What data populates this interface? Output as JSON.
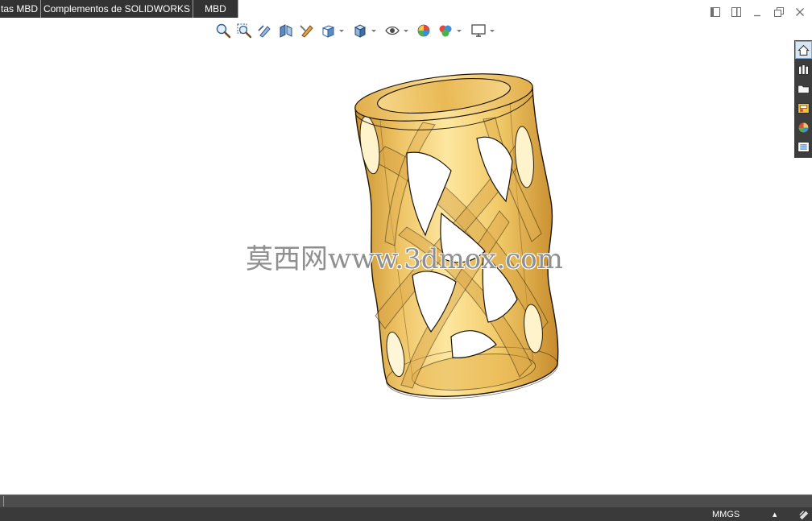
{
  "tabs": [
    {
      "label": "tas MBD"
    },
    {
      "label": "Complementos de SOLIDWORKS"
    },
    {
      "label": "MBD"
    }
  ],
  "view_toolbar": {
    "items": [
      {
        "icon": "zoom-to-fit-icon",
        "dropdown": false
      },
      {
        "icon": "zoom-to-area-icon",
        "dropdown": false
      },
      {
        "icon": "previous-view-icon",
        "dropdown": false
      },
      {
        "icon": "section-view-icon",
        "dropdown": false
      },
      {
        "icon": "dynamic-annotation-view-icon",
        "dropdown": false
      },
      {
        "icon": "view-orientation-icon",
        "dropdown": true
      },
      {
        "icon": "display-style-icon",
        "dropdown": true
      },
      {
        "icon": "hide-show-items-icon",
        "dropdown": true
      },
      {
        "icon": "edit-appearance-icon",
        "dropdown": false
      },
      {
        "icon": "apply-scene-icon",
        "dropdown": true
      },
      {
        "icon": "view-settings-icon",
        "dropdown": true
      }
    ]
  },
  "window_controls": [
    "dock-left-icon",
    "dock-right-icon",
    "minimize-icon",
    "restore-icon",
    "close-icon"
  ],
  "task_pane": {
    "items": [
      {
        "icon": "home-icon",
        "active": true
      },
      {
        "icon": "design-library-icon",
        "active": false
      },
      {
        "icon": "file-explorer-icon",
        "active": false
      },
      {
        "icon": "view-palette-icon",
        "active": false
      },
      {
        "icon": "appearances-icon",
        "active": false
      },
      {
        "icon": "custom-properties-icon",
        "active": false
      }
    ]
  },
  "graphics": {
    "watermark": "莫西网www.3dmox.com"
  },
  "status_bar": {
    "units": "MMGS",
    "units_menu_arrow": "▲",
    "icon": "sketch-mode-icon"
  },
  "colors": {
    "tab_background": "#333333",
    "status_background": "#3a3a3a",
    "model_gold": "#f3cb6a",
    "task_pane_active": "#d8e6f4"
  }
}
